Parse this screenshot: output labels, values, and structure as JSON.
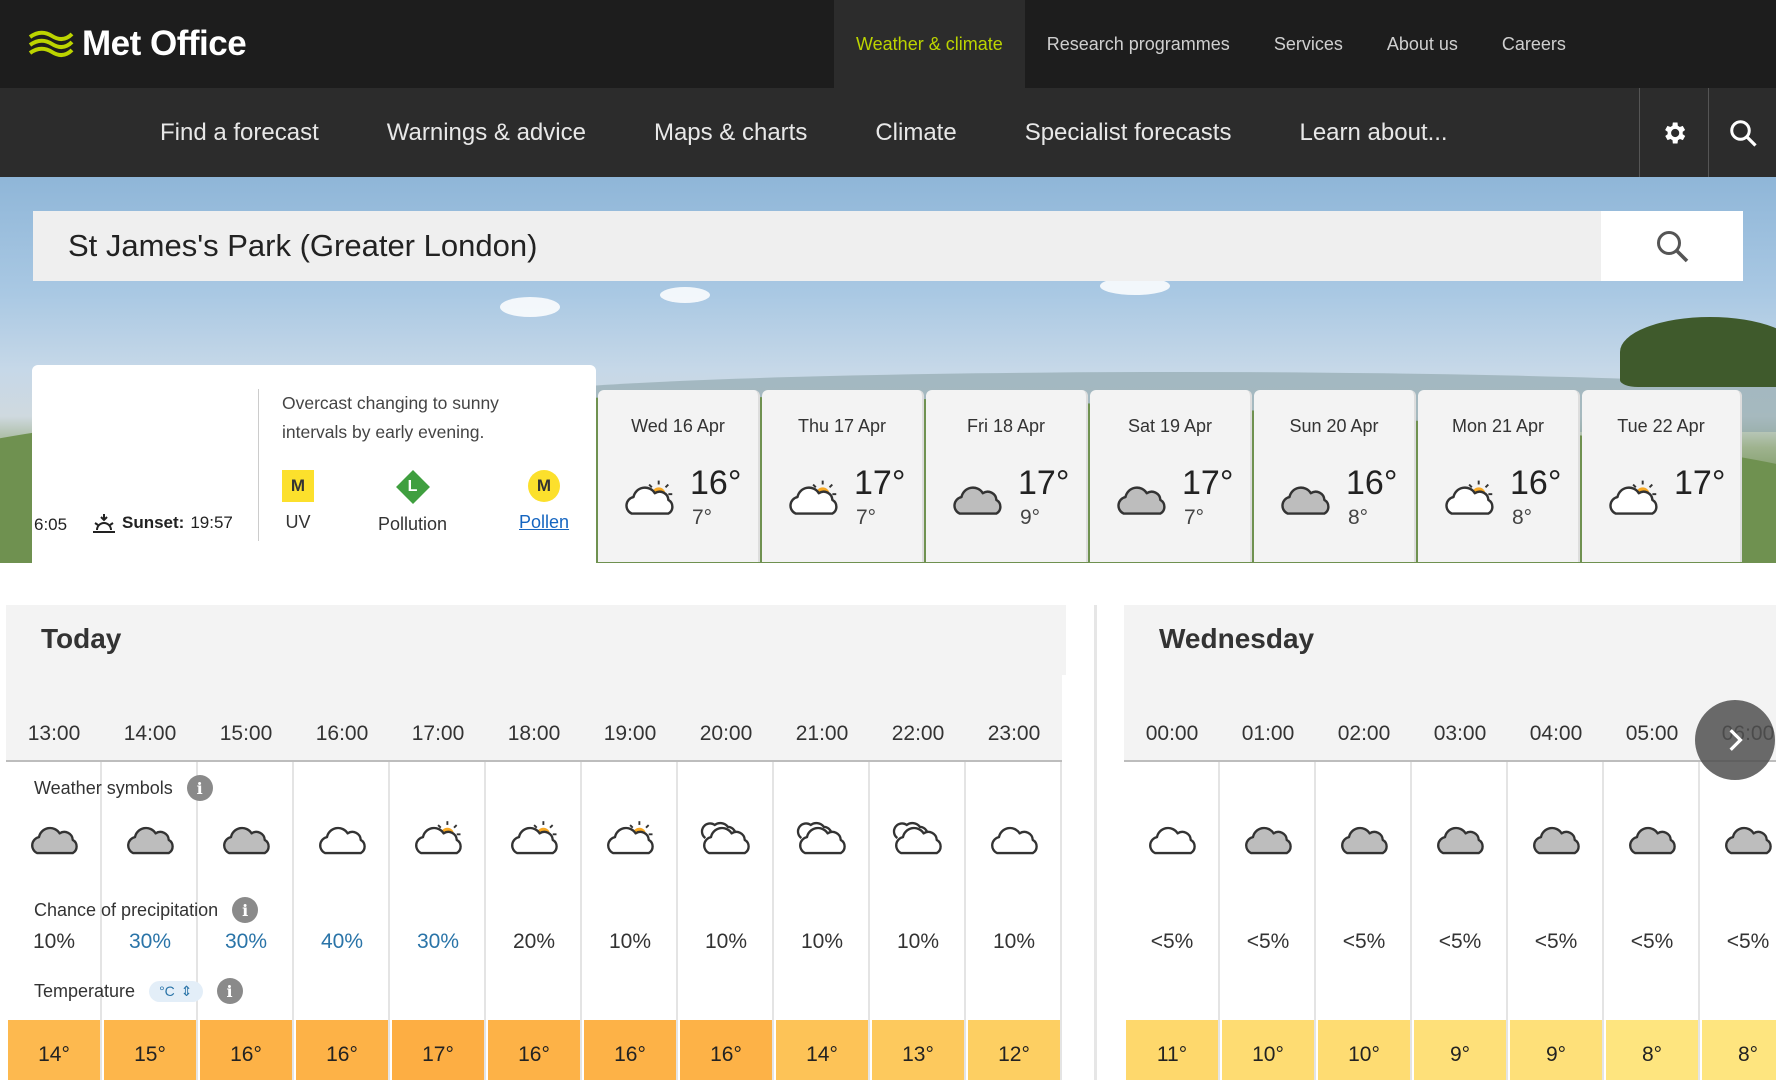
{
  "brand": {
    "name": "Met Office"
  },
  "top_nav": [
    {
      "label": "Weather & climate",
      "active": true
    },
    {
      "label": "Research programmes"
    },
    {
      "label": "Services"
    },
    {
      "label": "About us"
    },
    {
      "label": "Careers"
    }
  ],
  "main_nav": [
    "Find a forecast",
    "Warnings & advice",
    "Maps & charts",
    "Climate",
    "Specialist forecasts",
    "Learn about..."
  ],
  "search": {
    "value": "St James's Park (Greater London)"
  },
  "today_summary": {
    "sunrise": "6:05",
    "sunset_label": "Sunset:",
    "sunset_time": "19:57",
    "description": "Overcast changing to sunny intervals by early evening.",
    "uv": {
      "level": "M",
      "label": "UV"
    },
    "pollution": {
      "level": "L",
      "label": "Pollution"
    },
    "pollen": {
      "level": "M",
      "label": "Pollen"
    }
  },
  "days": [
    {
      "name": "Wed 16 Apr",
      "icon": "sunny-intervals-icon",
      "hi": "16°",
      "lo": "7°"
    },
    {
      "name": "Thu 17 Apr",
      "icon": "sunny-intervals-icon",
      "hi": "17°",
      "lo": "7°"
    },
    {
      "name": "Fri 18 Apr",
      "icon": "cloudy-icon",
      "hi": "17°",
      "lo": "9°"
    },
    {
      "name": "Sat 19 Apr",
      "icon": "cloudy-icon",
      "hi": "17°",
      "lo": "7°"
    },
    {
      "name": "Sun 20 Apr",
      "icon": "cloudy-icon",
      "hi": "16°",
      "lo": "8°"
    },
    {
      "name": "Mon 21 Apr",
      "icon": "sunny-intervals-icon",
      "hi": "16°",
      "lo": "8°"
    },
    {
      "name": "Tue 22 Apr",
      "icon": "sunny-intervals-icon",
      "hi": "17°",
      "lo": ""
    }
  ],
  "hourly_labels": {
    "weather_symbols": "Weather symbols",
    "precipitation": "Chance of precipitation",
    "temperature": "Temperature",
    "unit": "°C"
  },
  "today_panel": {
    "title": "Today",
    "hours": [
      {
        "time": "13:00",
        "icon": "cloudy-icon",
        "precip": "10%",
        "temp": "14°",
        "color": "#fdb94f"
      },
      {
        "time": "14:00",
        "icon": "cloudy-icon",
        "precip": "30%",
        "temp": "15°",
        "color": "#fdb64b"
      },
      {
        "time": "15:00",
        "icon": "cloudy-icon",
        "precip": "30%",
        "temp": "16°",
        "color": "#fdb247"
      },
      {
        "time": "16:00",
        "icon": "cloudy-light-icon",
        "precip": "40%",
        "temp": "16°",
        "color": "#fdb247"
      },
      {
        "time": "17:00",
        "icon": "sunny-intervals-icon",
        "precip": "30%",
        "temp": "17°",
        "color": "#fdae43"
      },
      {
        "time": "18:00",
        "icon": "sunny-intervals-icon",
        "precip": "20%",
        "temp": "16°",
        "color": "#fdb247"
      },
      {
        "time": "19:00",
        "icon": "sunny-intervals-icon",
        "precip": "10%",
        "temp": "16°",
        "color": "#fdb247"
      },
      {
        "time": "20:00",
        "icon": "partly-cloudy-night-icon",
        "precip": "10%",
        "temp": "16°",
        "color": "#fdb247"
      },
      {
        "time": "21:00",
        "icon": "partly-cloudy-night-icon",
        "precip": "10%",
        "temp": "14°",
        "color": "#fdc357"
      },
      {
        "time": "22:00",
        "icon": "partly-cloudy-night-icon",
        "precip": "10%",
        "temp": "13°",
        "color": "#fdc95d"
      },
      {
        "time": "23:00",
        "icon": "cloudy-light-icon",
        "precip": "10%",
        "temp": "12°",
        "color": "#fdcf62"
      }
    ]
  },
  "wednesday_panel": {
    "title": "Wednesday",
    "hours": [
      {
        "time": "00:00",
        "icon": "cloudy-light-icon",
        "precip": "<5%",
        "temp": "11°",
        "color": "#fed86c"
      },
      {
        "time": "01:00",
        "icon": "cloudy-icon",
        "precip": "<5%",
        "temp": "10°",
        "color": "#fedc72"
      },
      {
        "time": "02:00",
        "icon": "cloudy-icon",
        "precip": "<5%",
        "temp": "10°",
        "color": "#fedc72"
      },
      {
        "time": "03:00",
        "icon": "cloudy-icon",
        "precip": "<5%",
        "temp": "9°",
        "color": "#fee079"
      },
      {
        "time": "04:00",
        "icon": "cloudy-icon",
        "precip": "<5%",
        "temp": "9°",
        "color": "#fee079"
      },
      {
        "time": "05:00",
        "icon": "cloudy-icon",
        "precip": "<5%",
        "temp": "8°",
        "color": "#fee57f"
      },
      {
        "time": "06:00",
        "icon": "cloudy-icon",
        "precip": "<5%",
        "temp": "8°",
        "color": "#fee57f"
      }
    ]
  }
}
